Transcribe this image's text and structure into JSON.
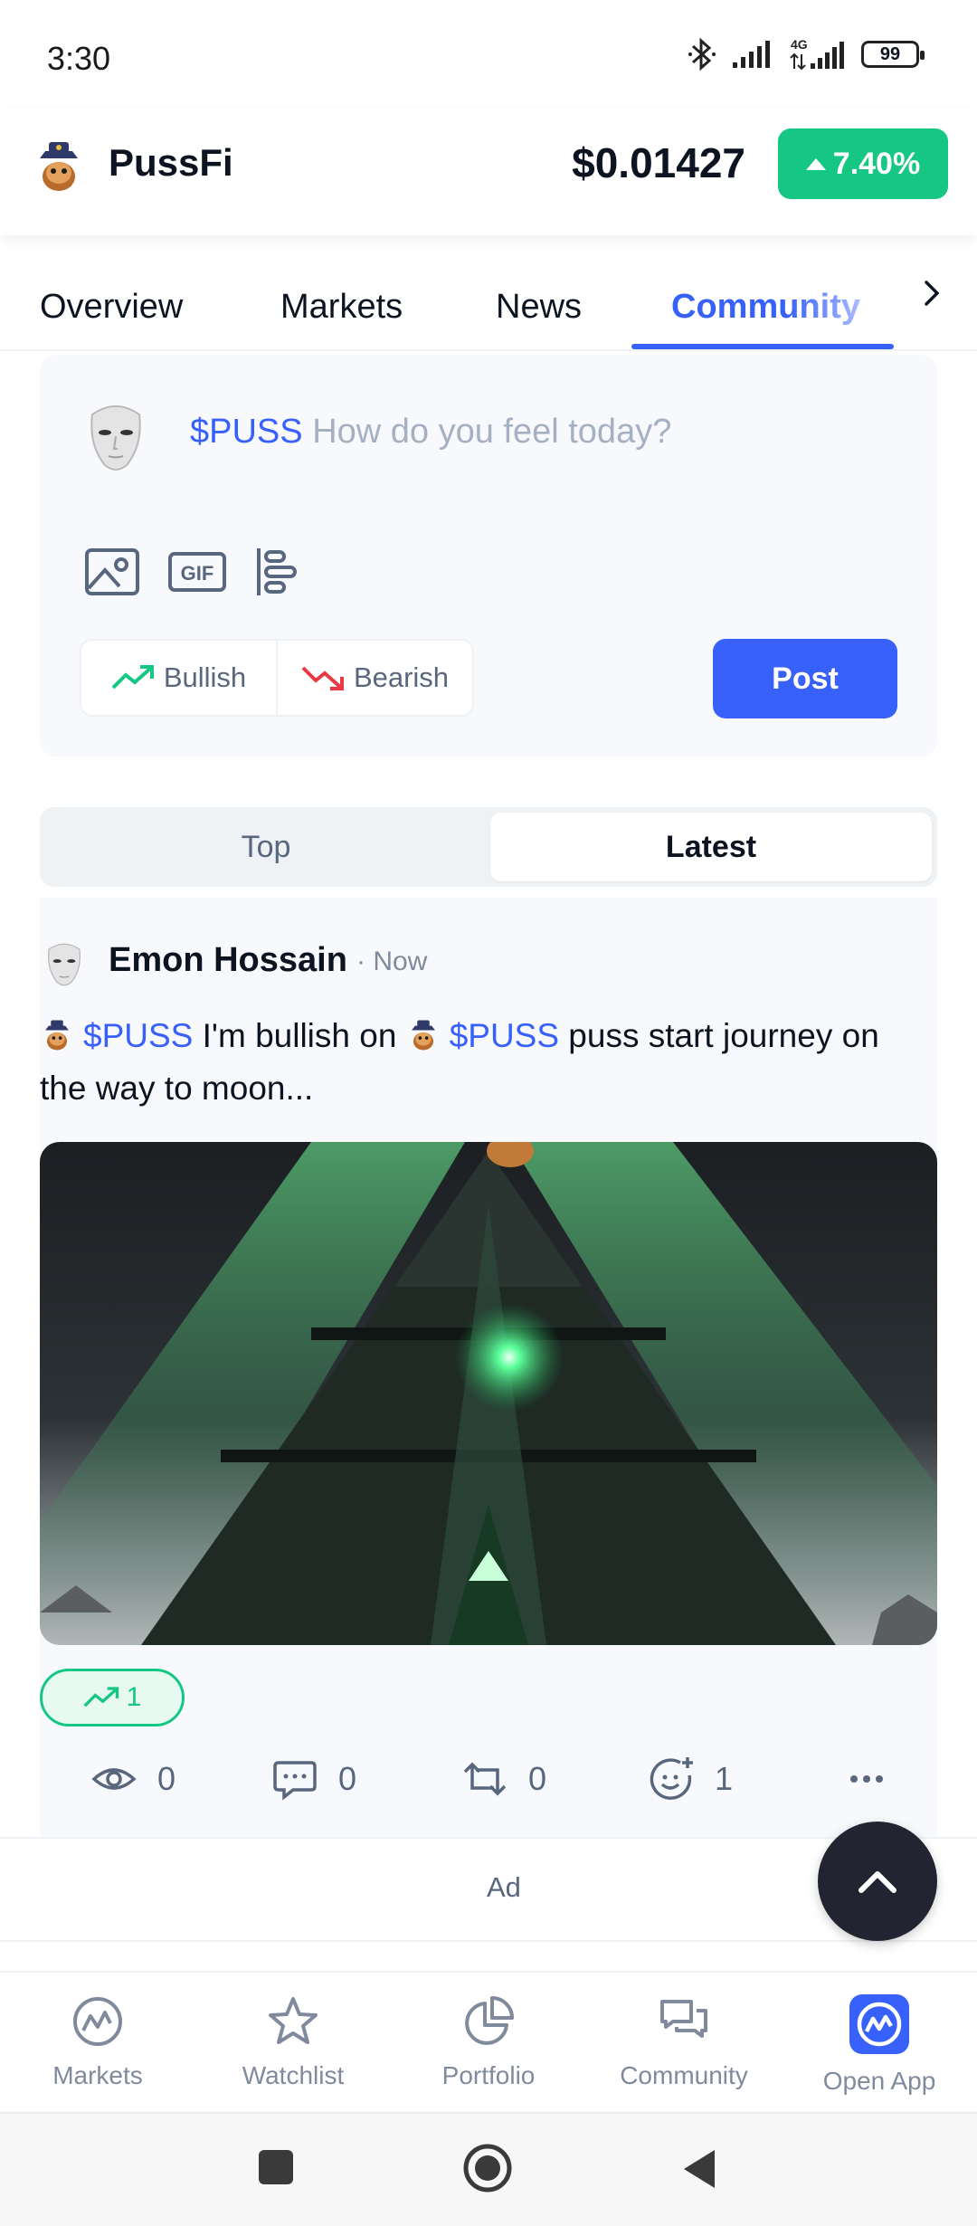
{
  "status_bar": {
    "time": "3:30",
    "battery": "99",
    "network": "4G"
  },
  "coin": {
    "name": "PussFi",
    "price": "$0.01427",
    "change": "7.40%"
  },
  "tabs": [
    {
      "label": "Overview"
    },
    {
      "label": "Markets"
    },
    {
      "label": "News"
    },
    {
      "label": "Community"
    }
  ],
  "composer": {
    "ticker": "$PUSS",
    "placeholder": "How do you feel today?",
    "bullish_label": "Bullish",
    "bearish_label": "Bearish",
    "post_label": "Post"
  },
  "feed_toggle": {
    "top": "Top",
    "latest": "Latest"
  },
  "post": {
    "author": "Emon Hossain",
    "time": "· Now",
    "ticker1": "$PUSS",
    "text1": " I'm bullish on ",
    "ticker2": "$PUSS",
    "text2": " puss start journey on the way to moon...",
    "bullish_count": "1",
    "views": "0",
    "comments": "0",
    "reposts": "0",
    "reactions": "1"
  },
  "ad": {
    "label": "Ad"
  },
  "bottom_nav": [
    {
      "label": "Markets"
    },
    {
      "label": "Watchlist"
    },
    {
      "label": "Portfolio"
    },
    {
      "label": "Community"
    },
    {
      "label": "Open App"
    }
  ],
  "colors": {
    "brand": "#3861fb",
    "positive": "#16c784",
    "negative": "#ea3943"
  }
}
